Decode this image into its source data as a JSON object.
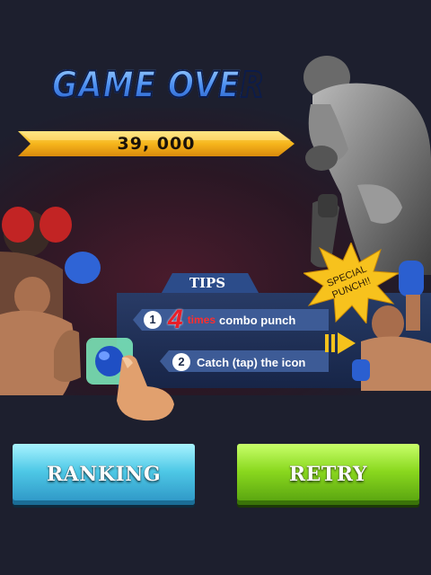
{
  "game": {
    "title": "GAME OVER",
    "score": "39, 000"
  },
  "tips": {
    "label": "TIPS",
    "items": [
      {
        "number": "1",
        "highlight": "4",
        "highlight_word": "times",
        "text": "combo punch"
      },
      {
        "number": "2",
        "text": "Catch (tap) the icon"
      }
    ],
    "burst_line1": "SPECIAL",
    "burst_line2": "PUNCH!!"
  },
  "buttons": {
    "ranking": "RANKING",
    "retry": "RETRY"
  },
  "colors": {
    "background": "#1d1f2e",
    "ribbon": "#f6b51c",
    "ranking": "#4ec8e6",
    "retry": "#8ad81e",
    "tips_panel": "#1e3358"
  }
}
